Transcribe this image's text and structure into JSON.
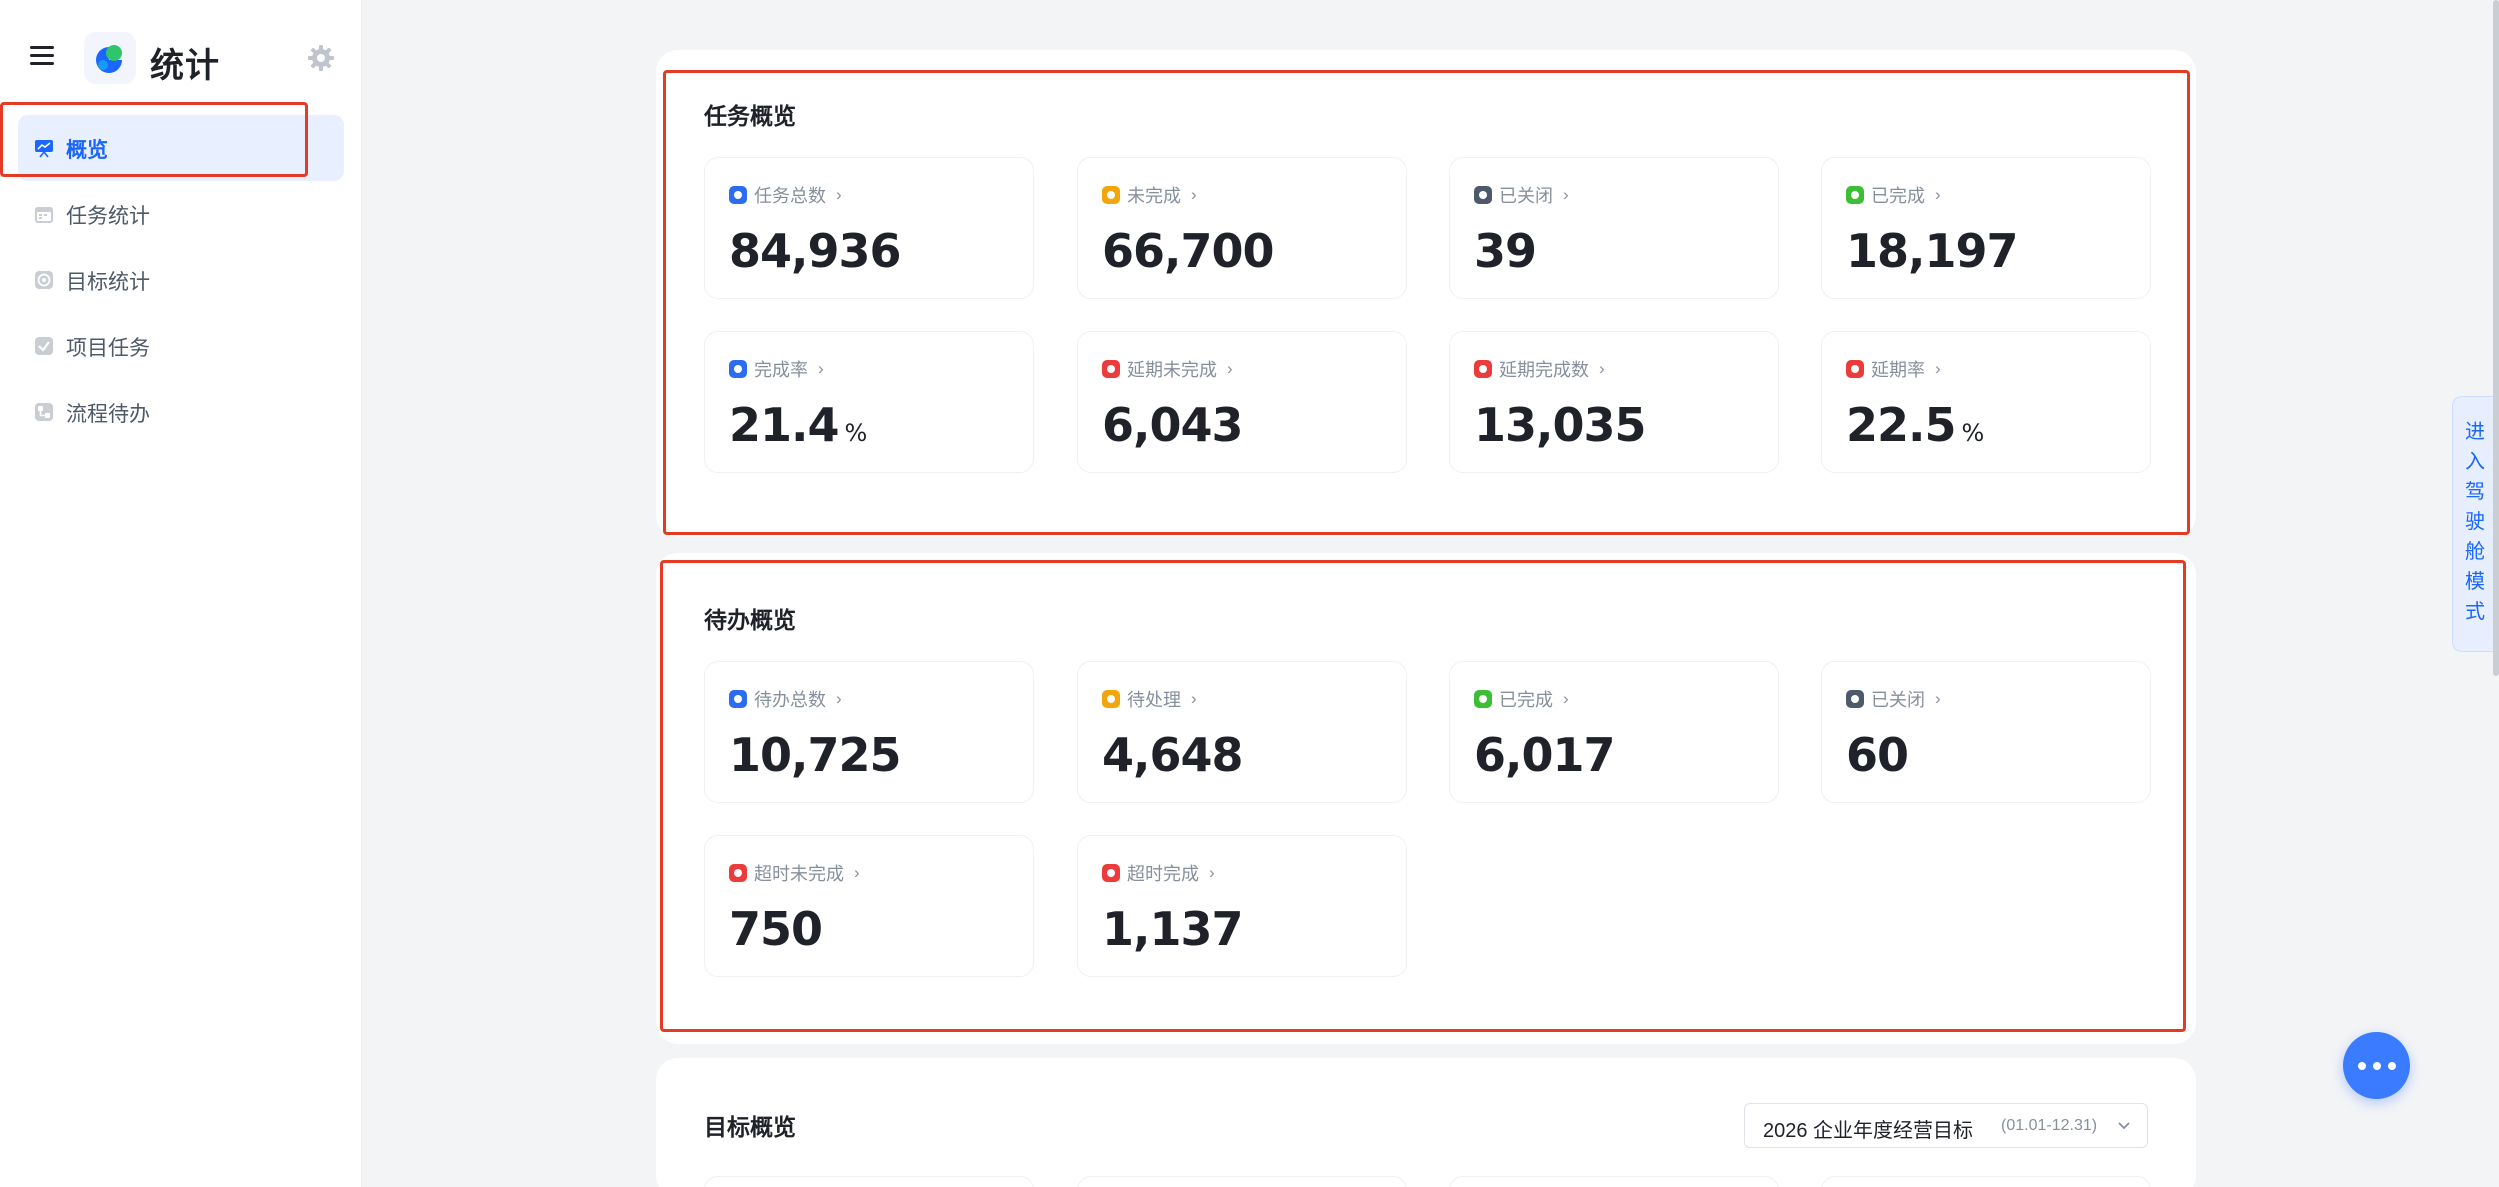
{
  "app": {
    "title": "统计"
  },
  "sidebar": {
    "items": [
      {
        "label": "概览",
        "icon": "presentation-chart-icon",
        "active": true
      },
      {
        "label": "任务统计",
        "icon": "task-calendar-icon",
        "active": false
      },
      {
        "label": "目标统计",
        "icon": "target-icon",
        "active": false
      },
      {
        "label": "项目任务",
        "icon": "checkbox-icon",
        "active": false
      },
      {
        "label": "流程待办",
        "icon": "flow-icon",
        "active": false
      }
    ]
  },
  "task_overview": {
    "title": "任务概览",
    "cards": [
      {
        "label": "任务总数",
        "value": "84,936",
        "unit": "",
        "color": "#2b6cf0"
      },
      {
        "label": "未完成",
        "value": "66,700",
        "unit": "",
        "color": "#f2a60c"
      },
      {
        "label": "已关闭",
        "value": "39",
        "unit": "",
        "color": "#4e5969"
      },
      {
        "label": "已完成",
        "value": "18,197",
        "unit": "",
        "color": "#3cbf35"
      },
      {
        "label": "完成率",
        "value": "21.4",
        "unit": "%",
        "color": "#2b6cf0"
      },
      {
        "label": "延期未完成",
        "value": "6,043",
        "unit": "",
        "color": "#eb3b3b"
      },
      {
        "label": "延期完成数",
        "value": "13,035",
        "unit": "",
        "color": "#eb3b3b"
      },
      {
        "label": "延期率",
        "value": "22.5",
        "unit": "%",
        "color": "#eb3b3b"
      }
    ]
  },
  "todo_overview": {
    "title": "待办概览",
    "cards": [
      {
        "label": "待办总数",
        "value": "10,725",
        "unit": "",
        "color": "#2b6cf0"
      },
      {
        "label": "待处理",
        "value": "4,648",
        "unit": "",
        "color": "#f2a60c"
      },
      {
        "label": "已完成",
        "value": "6,017",
        "unit": "",
        "color": "#3cbf35"
      },
      {
        "label": "已关闭",
        "value": "60",
        "unit": "",
        "color": "#4e5969"
      },
      {
        "label": "超时未完成",
        "value": "750",
        "unit": "",
        "color": "#eb3b3b"
      },
      {
        "label": "超时完成",
        "value": "1,137",
        "unit": "",
        "color": "#eb3b3b"
      }
    ]
  },
  "goal_overview": {
    "title": "目标概览",
    "selector": {
      "value": "2026 企业年度经营目标",
      "suffix": "(01.01-12.31)"
    }
  },
  "cockpit": {
    "label": "进入驾驶舱模式"
  },
  "chevron": "›"
}
